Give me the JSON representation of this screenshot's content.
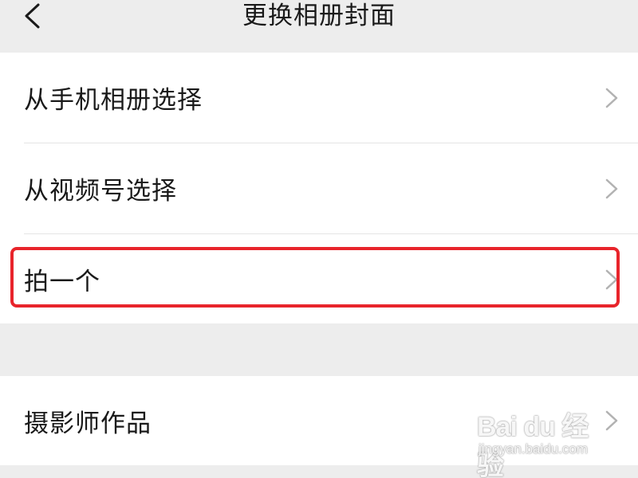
{
  "header": {
    "title": "更换相册封面",
    "back_icon": "chevron-left-icon"
  },
  "options": [
    {
      "label": "从手机相册选择",
      "icon": "chevron-right-icon"
    },
    {
      "label": "从视频号选择",
      "icon": "chevron-right-icon"
    },
    {
      "label": "拍一个",
      "icon": "chevron-right-icon",
      "highlighted": true
    }
  ],
  "extra": {
    "label": "摄影师作品",
    "icon": "chevron-right-icon"
  },
  "watermark": {
    "main": "Bai du 经验",
    "sub": "jingyan.baidu.com"
  },
  "colors": {
    "background": "#ededed",
    "card": "#ffffff",
    "highlight": "#e8242b",
    "chevron": "#b2b2b2"
  }
}
